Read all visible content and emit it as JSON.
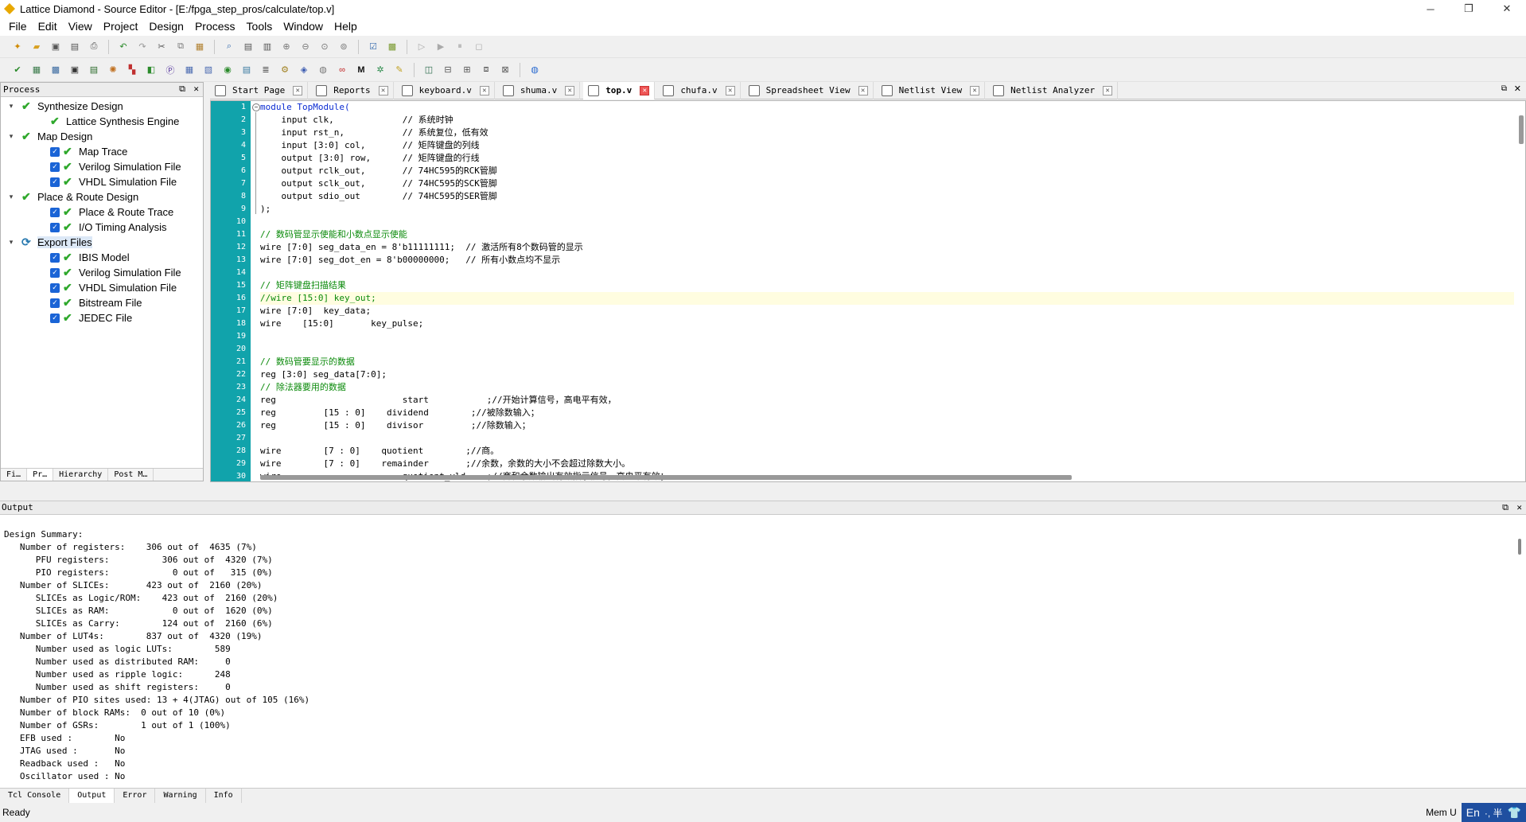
{
  "window": {
    "title": "Lattice Diamond - Source Editor - [E:/fpga_step_pros/calculate/top.v]",
    "controls": [
      "─",
      "❐",
      "✕"
    ]
  },
  "menu": [
    "File",
    "Edit",
    "View",
    "Project",
    "Design",
    "Process",
    "Tools",
    "Window",
    "Help"
  ],
  "process_panel": {
    "title": "Process",
    "items": [
      {
        "label": "Synthesize Design",
        "level": 0,
        "twisty": "▾",
        "kind": "tick"
      },
      {
        "label": "Lattice Synthesis Engine",
        "level": 1,
        "twisty": "",
        "kind": "tick"
      },
      {
        "label": "Map Design",
        "level": 0,
        "twisty": "▾",
        "kind": "tick"
      },
      {
        "label": "Map Trace",
        "level": 1,
        "twisty": "",
        "kind": "check"
      },
      {
        "label": "Verilog Simulation File",
        "level": 1,
        "twisty": "",
        "kind": "check"
      },
      {
        "label": "VHDL Simulation File",
        "level": 1,
        "twisty": "",
        "kind": "check"
      },
      {
        "label": "Place & Route Design",
        "level": 0,
        "twisty": "▾",
        "kind": "tick"
      },
      {
        "label": "Place & Route Trace",
        "level": 1,
        "twisty": "",
        "kind": "check"
      },
      {
        "label": "I/O Timing Analysis",
        "level": 1,
        "twisty": "",
        "kind": "check"
      },
      {
        "label": "Export Files",
        "level": 0,
        "twisty": "▾",
        "kind": "refresh"
      },
      {
        "label": "IBIS Model",
        "level": 1,
        "twisty": "",
        "kind": "check"
      },
      {
        "label": "Verilog Simulation File",
        "level": 1,
        "twisty": "",
        "kind": "check"
      },
      {
        "label": "VHDL Simulation File",
        "level": 1,
        "twisty": "",
        "kind": "check"
      },
      {
        "label": "Bitstream File",
        "level": 1,
        "twisty": "",
        "kind": "check"
      },
      {
        "label": "JEDEC File",
        "level": 1,
        "twisty": "",
        "kind": "check"
      }
    ],
    "tabs": [
      "Fi…",
      "Pr…",
      "Hierarchy",
      "Post M…"
    ],
    "active_tab": 1
  },
  "editor_tabs": [
    {
      "label": "Start Page"
    },
    {
      "label": "Reports"
    },
    {
      "label": "keyboard.v"
    },
    {
      "label": "shuma.v"
    },
    {
      "label": "top.v",
      "active": true
    },
    {
      "label": "chufa.v"
    },
    {
      "label": "Spreadsheet View"
    },
    {
      "label": "Netlist View"
    },
    {
      "label": "Netlist Analyzer"
    }
  ],
  "code_lines": [
    {
      "n": "1",
      "text": "module TopModule(",
      "style": "kw"
    },
    {
      "n": "2",
      "text": "    input clk,             // 系统时钟"
    },
    {
      "n": "3",
      "text": "    input rst_n,           // 系统复位，低有效"
    },
    {
      "n": "4",
      "text": "    input [3:0] col,       // 矩阵键盘的列线"
    },
    {
      "n": "5",
      "text": "    output [3:0] row,      // 矩阵键盘的行线"
    },
    {
      "n": "6",
      "text": "    output rclk_out,       // 74HC595的RCK管脚"
    },
    {
      "n": "7",
      "text": "    output sclk_out,       // 74HC595的SCK管脚"
    },
    {
      "n": "8",
      "text": "    output sdio_out        // 74HC595的SER管脚"
    },
    {
      "n": "9",
      "text": ");"
    },
    {
      "n": "10",
      "text": ""
    },
    {
      "n": "11",
      "text": "// 数码管显示使能和小数点显示使能",
      "style": "cm"
    },
    {
      "n": "12",
      "text": "wire [7:0] seg_data_en = 8'b11111111;  // 激活所有8个数码管的显示"
    },
    {
      "n": "13",
      "text": "wire [7:0] seg_dot_en = 8'b00000000;   // 所有小数点均不显示"
    },
    {
      "n": "14",
      "text": ""
    },
    {
      "n": "15",
      "text": "// 矩阵键盘扫描结果",
      "style": "cm"
    },
    {
      "n": "16",
      "text": "//wire [15:0] key_out;",
      "style": "cm",
      "cur": true
    },
    {
      "n": "17",
      "text": "wire [7:0]  key_data;"
    },
    {
      "n": "18",
      "text": "wire    [15:0]       key_pulse;"
    },
    {
      "n": "19",
      "text": ""
    },
    {
      "n": "20",
      "text": ""
    },
    {
      "n": "21",
      "text": "// 数码管要显示的数据",
      "style": "cm"
    },
    {
      "n": "22",
      "text": "reg [3:0] seg_data[7:0];"
    },
    {
      "n": "23",
      "text": "// 除法器要用的数据",
      "style": "cm"
    },
    {
      "n": "24",
      "text": "reg                        start           ;//开始计算信号，高电平有效，"
    },
    {
      "n": "25",
      "text": "reg         [15 : 0]    dividend        ;//被除数输入；"
    },
    {
      "n": "26",
      "text": "reg         [15 : 0]    divisor         ;//除数输入；"
    },
    {
      "n": "27",
      "text": ""
    },
    {
      "n": "28",
      "text": "wire        [7 : 0]    quotient        ;//商。"
    },
    {
      "n": "29",
      "text": "wire        [7 : 0]    remainder       ;//余数，余数的大小不会超过除数大小。"
    },
    {
      "n": "30",
      "text": "wire                       quotient_vld    ;//商和余数输出有效指示信号，高电平有效；"
    }
  ],
  "output": {
    "title": "Output",
    "lines": [
      "Design Summary:",
      "   Number of registers:    306 out of  4635 (7%)",
      "      PFU registers:          306 out of  4320 (7%)",
      "      PIO registers:            0 out of   315 (0%)",
      "   Number of SLICEs:       423 out of  2160 (20%)",
      "      SLICEs as Logic/ROM:    423 out of  2160 (20%)",
      "      SLICEs as RAM:            0 out of  1620 (0%)",
      "      SLICEs as Carry:        124 out of  2160 (6%)",
      "   Number of LUT4s:        837 out of  4320 (19%)",
      "      Number used as logic LUTs:        589",
      "      Number used as distributed RAM:     0",
      "      Number used as ripple logic:      248",
      "      Number used as shift registers:     0",
      "   Number of PIO sites used: 13 + 4(JTAG) out of 105 (16%)",
      "   Number of block RAMs:  0 out of 10 (0%)",
      "   Number of GSRs:        1 out of 1 (100%)",
      "   EFB used :        No",
      "   JTAG used :       No",
      "   Readback used :   No",
      "   Oscillator used : No"
    ],
    "tabs": [
      "Tcl Console",
      "Output",
      "Error",
      "Warning",
      "Info"
    ],
    "active_tab": 1
  },
  "status": {
    "text": "Ready",
    "mem": "Mem U",
    "ime": "En",
    "ime_extra": "·, 半"
  }
}
